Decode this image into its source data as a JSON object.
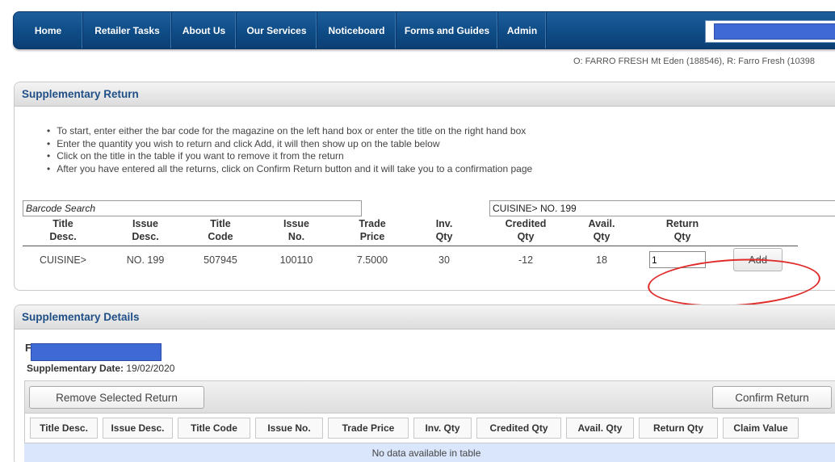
{
  "nav": {
    "items": [
      {
        "label": "Home"
      },
      {
        "label": "Retailer Tasks"
      },
      {
        "label": "About Us"
      },
      {
        "label": "Our Services"
      },
      {
        "label": "Noticeboard"
      },
      {
        "label": "Forms and Guides"
      },
      {
        "label": "Admin"
      }
    ]
  },
  "location_line": "O: FARRO FRESH Mt Eden (188546), R: Farro Fresh (10398",
  "supplementary_return": {
    "title": "Supplementary Return",
    "instructions": [
      "To start, enter either the bar code for the magazine on the left hand box or enter the title on the right hand box",
      "Enter the quantity you wish to return and click Add, it will then show up on the table below",
      "Click on the title in the table if you want to remove it from the return",
      "After you have entered all the returns, click on Confirm Return button and it will take you to a confirmation page"
    ],
    "barcode_search_value": "Barcode Search",
    "title_search_value": "CUISINE> NO. 199",
    "columns": [
      {
        "line1": "Title",
        "line2": "Desc."
      },
      {
        "line1": "Issue",
        "line2": "Desc."
      },
      {
        "line1": "Title",
        "line2": "Code"
      },
      {
        "line1": "Issue",
        "line2": "No."
      },
      {
        "line1": "Trade",
        "line2": "Price"
      },
      {
        "line1": "Inv.",
        "line2": "Qty"
      },
      {
        "line1": "Credited",
        "line2": "Qty"
      },
      {
        "line1": "Avail.",
        "line2": "Qty"
      },
      {
        "line1": "Return",
        "line2": "Qty"
      }
    ],
    "row": [
      "CUISINE>",
      "NO. 199",
      "507945",
      "100110",
      "7.5000",
      "30",
      "-12",
      "18"
    ],
    "return_qty_value": "1",
    "add_label": "Add"
  },
  "supplementary_details": {
    "title": "Supplementary Details",
    "partial_letter": "F",
    "date_label": "Supplementary Date:",
    "date_value": "19/02/2020",
    "remove_label": "Remove Selected Return",
    "confirm_label": "Confirm Return",
    "table_headers": [
      "Title Desc.",
      "Issue Desc.",
      "Title Code",
      "Issue No.",
      "Trade Price",
      "Inv. Qty",
      "Credited Qty",
      "Avail. Qty",
      "Return Qty",
      "Claim Value"
    ],
    "empty_message": "No data available in table"
  },
  "colors": {
    "nav_bg": "#0f4c86",
    "panel_title": "#1f4f86",
    "annotation_red": "#e02b2b",
    "redaction_blue": "#3f6ad6",
    "empty_row_bg": "#dae6fb"
  }
}
